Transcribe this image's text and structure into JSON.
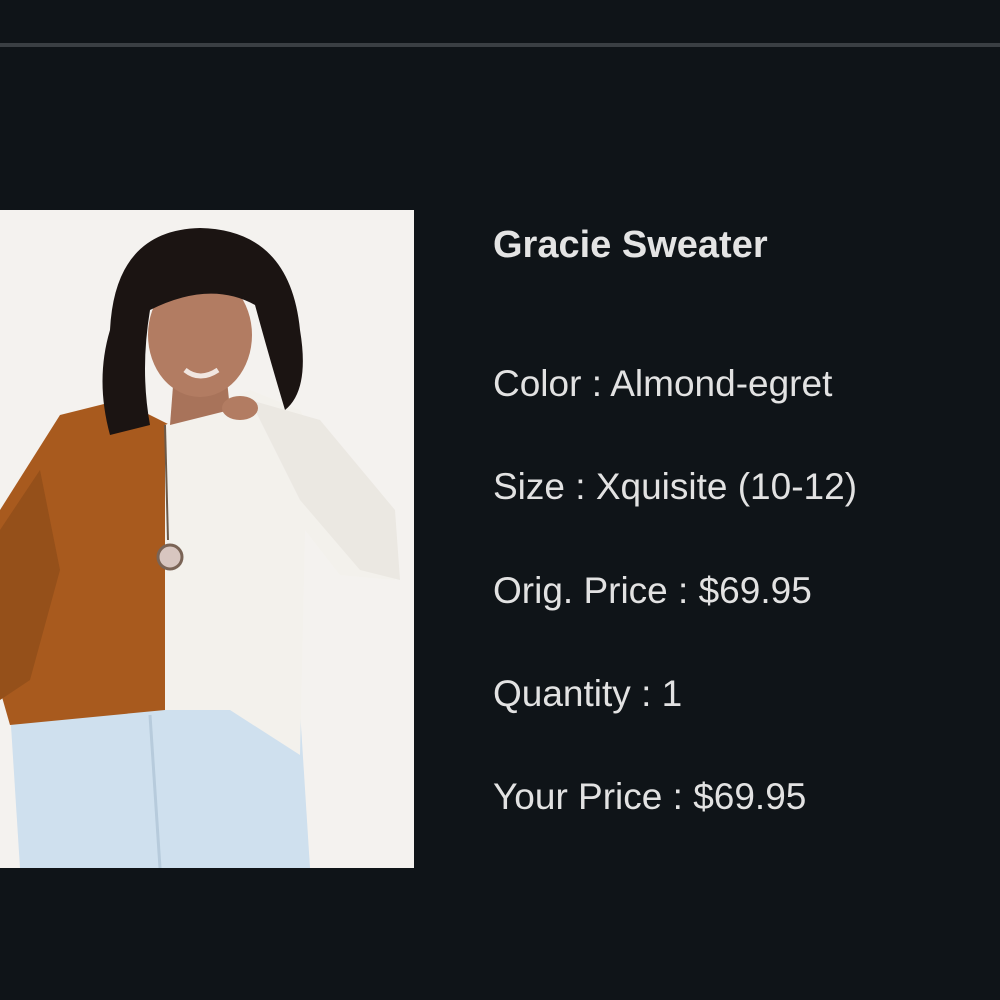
{
  "product": {
    "name": "Gracie Sweater",
    "image_alt": "Model wearing a two-tone brown and white sweater",
    "attributes": [
      {
        "label": "Color",
        "value": "Almond-egret"
      },
      {
        "label": "Size",
        "value": "Xquisite (10-12)"
      },
      {
        "label": "Orig. Price",
        "value": "$69.95"
      },
      {
        "label": "Quantity",
        "value": "1"
      },
      {
        "label": "Your Price",
        "value": "$69.95"
      }
    ],
    "separator": " : "
  },
  "colors": {
    "background": "#0f1418",
    "rule": "#3a3f43",
    "text": "#e2e2e2",
    "sweater_brown": "#a85a1e",
    "sweater_white": "#f3f1ec",
    "jeans": "#cfe0ee"
  }
}
